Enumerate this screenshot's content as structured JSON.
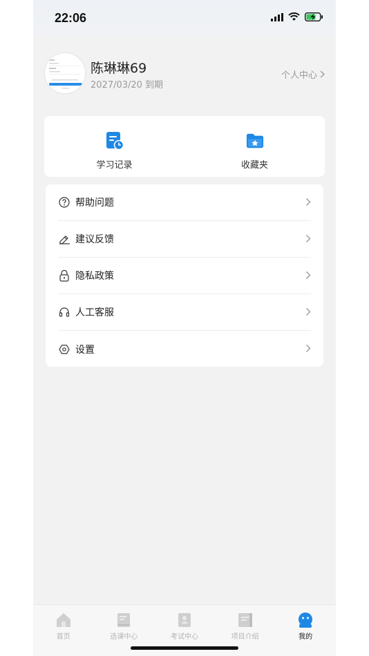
{
  "status_bar": {
    "time": "22:06"
  },
  "profile": {
    "username": "陈琳琳69",
    "expire": "2027/03/20 到期",
    "center_link": "个人中心"
  },
  "quick_actions": [
    {
      "label": "学习记录",
      "icon": "study-record-icon"
    },
    {
      "label": "收藏夹",
      "icon": "favorites-folder-icon"
    }
  ],
  "menu": [
    {
      "label": "帮助问题",
      "icon": "help-question-icon"
    },
    {
      "label": "建议反馈",
      "icon": "feedback-pen-icon"
    },
    {
      "label": "隐私政策",
      "icon": "privacy-lock-icon"
    },
    {
      "label": "人工客服",
      "icon": "headset-icon"
    },
    {
      "label": "设置",
      "icon": "settings-gear-icon"
    }
  ],
  "tabs": [
    {
      "label": "首页",
      "icon": "home-icon",
      "active": false
    },
    {
      "label": "选课中心",
      "icon": "course-book-icon",
      "active": false
    },
    {
      "label": "考试中心",
      "icon": "exam-icon",
      "active": false
    },
    {
      "label": "项目介绍",
      "icon": "project-icon",
      "active": false
    },
    {
      "label": "我的",
      "icon": "profile-robot-icon",
      "active": true
    }
  ],
  "colors": {
    "accent": "#1e88e5",
    "background": "#f2f2f3",
    "inactive_tab": "#c8c8c8"
  }
}
